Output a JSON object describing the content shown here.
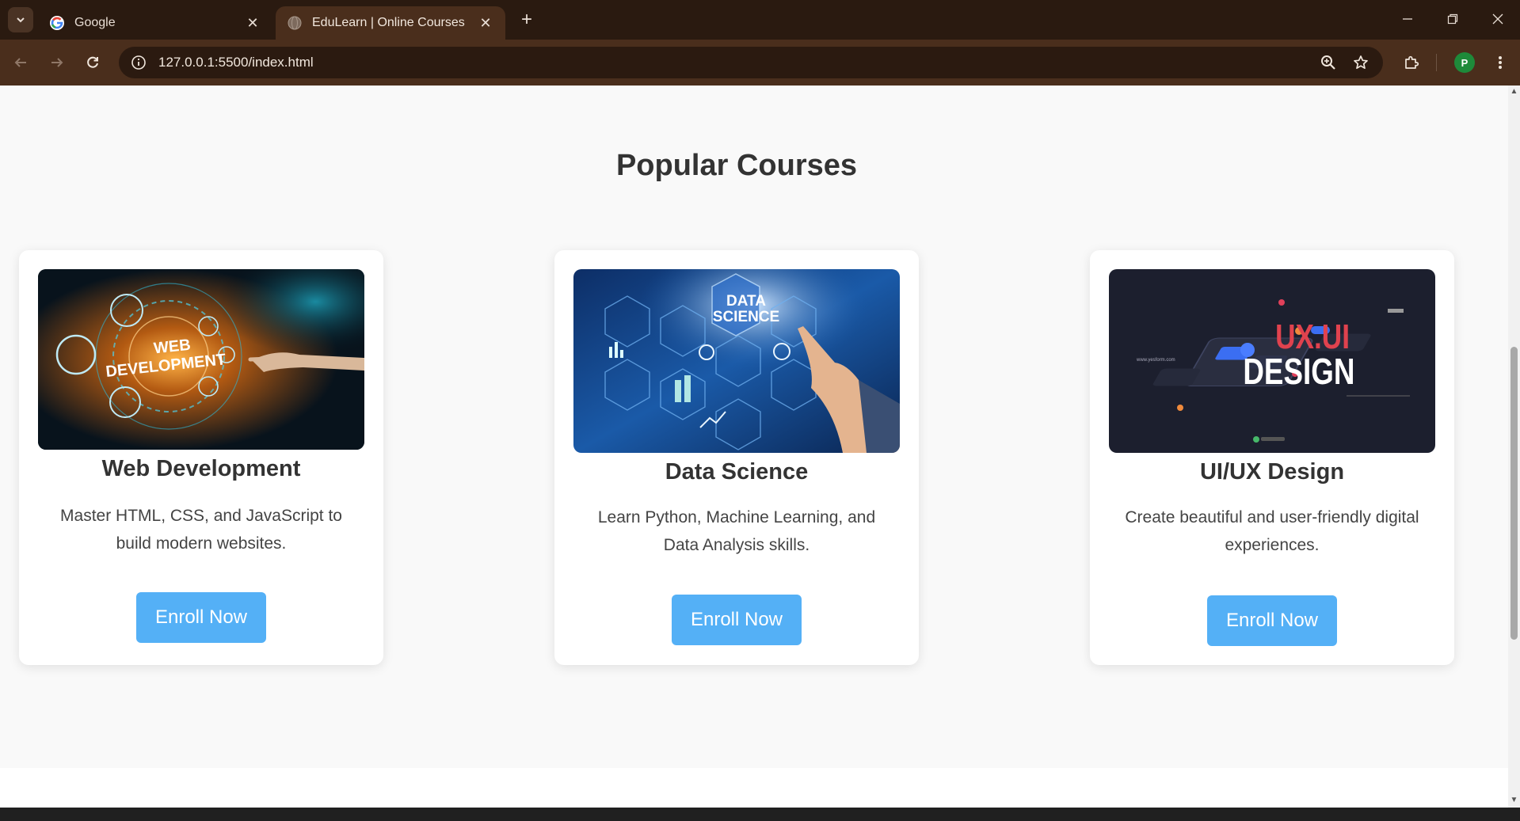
{
  "browser": {
    "tabs": [
      {
        "title": "Google",
        "icon": "google-icon"
      },
      {
        "title": "EduLearn | Online Courses",
        "icon": "globe-icon"
      }
    ],
    "address": "127.0.0.1:5500/index.html",
    "profile_initial": "P"
  },
  "page": {
    "section_title": "Popular Courses",
    "courses": [
      {
        "title": "Web Development",
        "description": "Master HTML, CSS, and JavaScript to build modern websites.",
        "button": "Enroll Now",
        "image_text": [
          "WEB",
          "DEVELOPMENT"
        ]
      },
      {
        "title": "Data Science",
        "description": "Learn Python, Machine Learning, and Data Analysis skills.",
        "button": "Enroll Now",
        "image_text": [
          "DATA",
          "SCIENCE"
        ]
      },
      {
        "title": "UI/UX Design",
        "description": "Create beautiful and user-friendly digital experiences.",
        "button": "Enroll Now",
        "image_text": [
          "UX.UI",
          "DESIGN"
        ]
      }
    ]
  },
  "colors": {
    "accent_button": "#54b0f6",
    "chrome_dark": "#2a1a10",
    "chrome_toolbar": "#4a2e1c"
  }
}
